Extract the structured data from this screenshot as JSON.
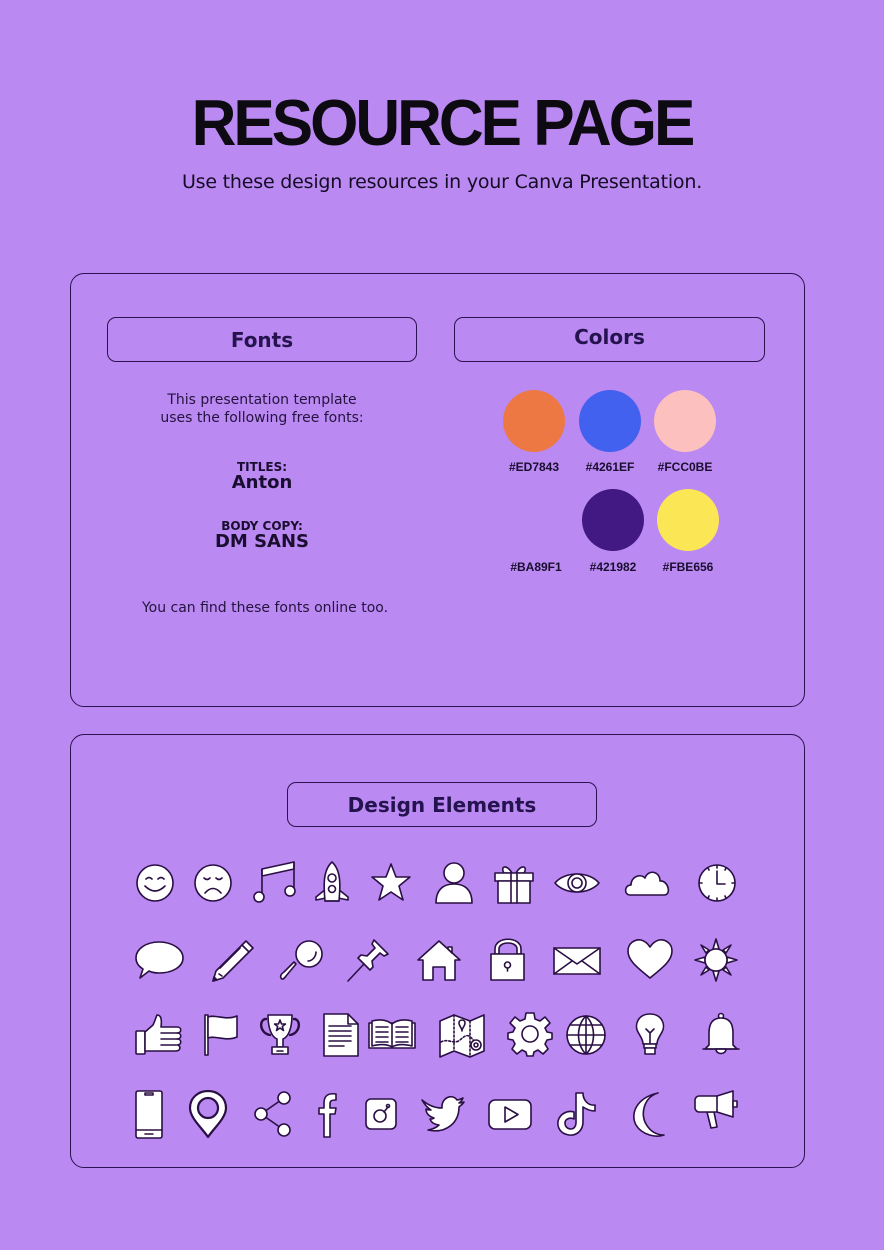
{
  "header": {
    "title": "RESOURCE PAGE",
    "subtitle": "Use these design resources in your Canva Presentation."
  },
  "fonts": {
    "heading": "Fonts",
    "intro_line1": "This presentation template",
    "intro_line2": "uses the following free fonts:",
    "titles_label": "TITLES:",
    "titles_font": "Anton",
    "body_label": "BODY COPY:",
    "body_font": "DM SANS",
    "footer": "You can find these fonts online too."
  },
  "colors": {
    "heading": "Colors",
    "swatches": [
      {
        "hex": "#ED7843",
        "label": "#ED7843"
      },
      {
        "hex": "#4261EF",
        "label": "#4261EF"
      },
      {
        "hex": "#FCC0BE",
        "label": "#FCC0BE"
      },
      {
        "hex": "#BA89F1",
        "label": "#BA89F1"
      },
      {
        "hex": "#421982",
        "label": "#421982"
      },
      {
        "hex": "#FBE656",
        "label": "#FBE656"
      }
    ]
  },
  "elements": {
    "heading": "Design Elements",
    "icons": [
      [
        "smiley-face",
        "sad-face",
        "music-note",
        "rocket",
        "star",
        "user",
        "gift",
        "eye",
        "cloud",
        "clock"
      ],
      [
        "speech-bubble",
        "pencil",
        "magnifying-glass",
        "push-pin",
        "house",
        "padlock",
        "envelope",
        "heart",
        "sun"
      ],
      [
        "thumbs-up",
        "flag",
        "trophy",
        "document",
        "open-book",
        "map",
        "gear",
        "globe",
        "lightbulb",
        "bell"
      ],
      [
        "smartphone",
        "location-pin",
        "share",
        "facebook",
        "instagram",
        "twitter",
        "youtube",
        "tiktok",
        "crescent-moon",
        "megaphone"
      ]
    ]
  },
  "theme": {
    "background": "#BA89F1",
    "outline": "#2B1250",
    "text_dark": "#1A0E30"
  }
}
